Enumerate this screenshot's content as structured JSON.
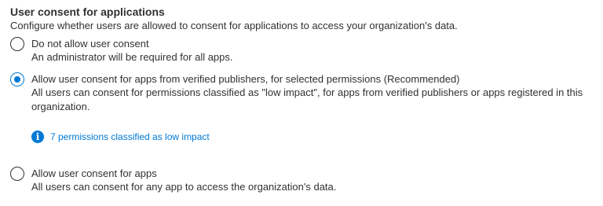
{
  "section": {
    "title": "User consent for applications",
    "description": "Configure whether users are allowed to consent for applications to access your organization's data."
  },
  "options": [
    {
      "label": "Do not allow user consent",
      "description": "An administrator will be required for all apps.",
      "selected": false
    },
    {
      "label": "Allow user consent for apps from verified publishers, for selected permissions (Recommended)",
      "description": "All users can consent for permissions classified as \"low impact\", for apps from verified publishers or apps registered in this organization.",
      "selected": true
    },
    {
      "label": "Allow user consent for apps",
      "description": "All users can consent for any app to access the organization's data.",
      "selected": false
    }
  ],
  "info": {
    "icon": "info-icon",
    "link_text": "7 permissions classified as low impact"
  },
  "colors": {
    "accent": "#0078d4",
    "text": "#323130"
  }
}
